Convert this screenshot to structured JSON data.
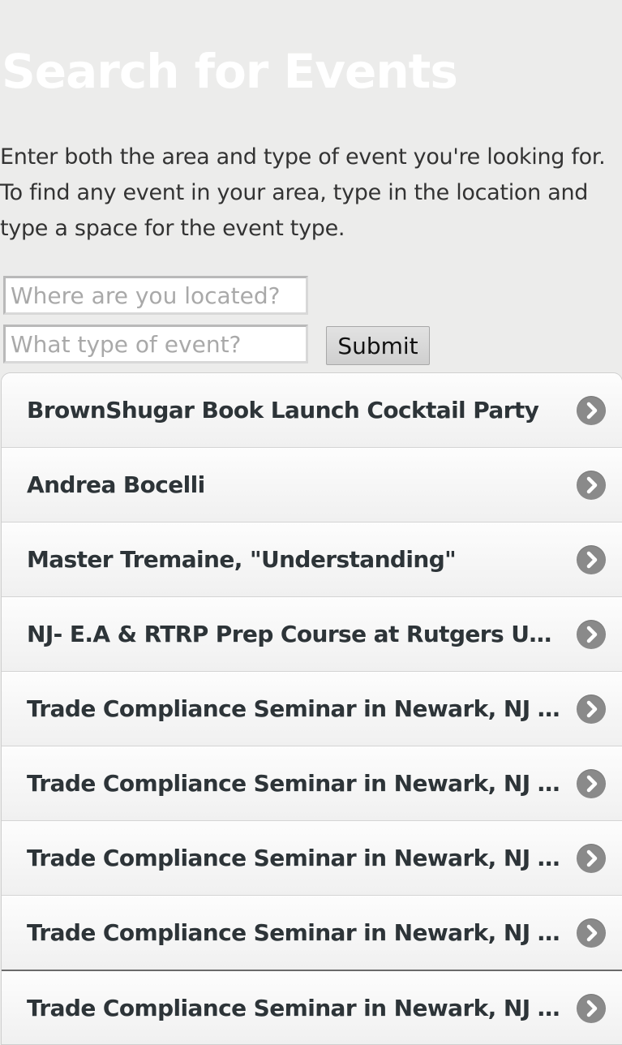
{
  "page": {
    "title": "Search for Events",
    "intro": "Enter both the area and type of event you're looking for. To find any event in your area, type in the location and type a space for the event type."
  },
  "search": {
    "location_placeholder": "Where are you located?",
    "location_value": "",
    "type_placeholder": "What type of event?",
    "type_value": "",
    "submit_label": "Submit"
  },
  "events": [
    {
      "label": "BrownShugar Book Launch Cocktail Party",
      "icon": "chevron-right-circle"
    },
    {
      "label": "Andrea Bocelli",
      "icon": "chevron-right-circle"
    },
    {
      "label": "Master Tremaine, \"Understanding\"",
      "icon": "chevron-right-circle"
    },
    {
      "label": "NJ- E.A & RTRP Prep Course at Rutgers Univ.",
      "icon": "chevron-right-circle"
    },
    {
      "label": "Trade Compliance Seminar in Newark, NJ 'Ex...",
      "icon": "chevron-right-circle"
    },
    {
      "label": "Trade Compliance Seminar in Newark, NJ 'Ex...",
      "icon": "chevron-right-circle"
    },
    {
      "label": "Trade Compliance Seminar in Newark, NJ 'Int...",
      "icon": "chevron-right-circle"
    },
    {
      "label": "Trade Compliance Seminar in Newark, NJ 'Ta...",
      "icon": "chevron-right-circle"
    },
    {
      "label": "Trade Compliance Seminar in Newark, NJ 'Im...",
      "icon": "chevron-right-circle"
    }
  ],
  "colors": {
    "background": "#ececeb",
    "title": "#ffffff",
    "list_text": "#2d3438",
    "arrow_icon": "#8a8a8a"
  }
}
